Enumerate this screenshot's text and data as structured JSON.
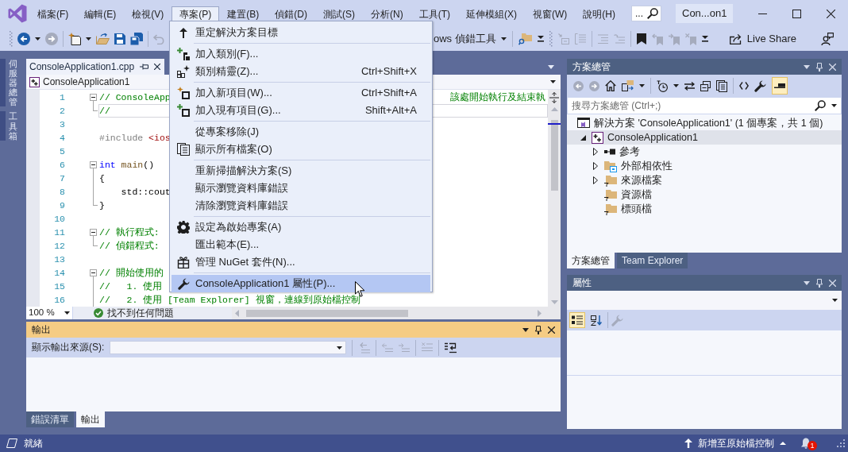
{
  "window": {
    "title": "Con...on1",
    "search": {
      "placeholder": "..."
    }
  },
  "menu_bar": [
    {
      "label": "檔案(F)",
      "selected": false
    },
    {
      "label": "編輯(E)",
      "selected": false
    },
    {
      "label": "檢視(V)",
      "selected": false
    },
    {
      "label": "專案(P)",
      "selected": true
    },
    {
      "label": "建置(B)",
      "selected": false
    },
    {
      "label": "偵錯(D)",
      "selected": false
    },
    {
      "label": "測試(S)",
      "selected": false
    },
    {
      "label": "分析(N)",
      "selected": false
    },
    {
      "label": "工具(T)",
      "selected": false
    },
    {
      "label": "延伸模組(X)",
      "selected": false
    },
    {
      "label": "視窗(W)",
      "selected": false
    },
    {
      "label": "說明(H)",
      "selected": false
    }
  ],
  "project_menu": {
    "groups": [
      [
        {
          "label": "重定解決方案目標",
          "selected": false
        }
      ],
      [
        {
          "label": "加入類別(F)...",
          "selected": false
        },
        {
          "label": "類別精靈(Z)...",
          "shortcut": "Ctrl+Shift+X",
          "selected": false
        }
      ],
      [
        {
          "label": "加入新項目(W)...",
          "shortcut": "Ctrl+Shift+A",
          "selected": false
        },
        {
          "label": "加入現有項目(G)...",
          "shortcut": "Shift+Alt+A",
          "selected": false
        }
      ],
      [
        {
          "label": "從專案移除(J)",
          "selected": false
        },
        {
          "label": "顯示所有檔案(O)",
          "selected": false
        }
      ],
      [
        {
          "label": "重新掃描解決方案(S)",
          "selected": false
        },
        {
          "label": "顯示瀏覽資料庫錯誤",
          "selected": false
        },
        {
          "label": "清除瀏覽資料庫錯誤",
          "selected": false
        }
      ],
      [
        {
          "label": "設定為啟始專案(A)",
          "selected": false
        },
        {
          "label": "匯出範本(E)...",
          "selected": false
        },
        {
          "label": "管理 NuGet 套件(N)...",
          "selected": false
        }
      ],
      [
        {
          "label": "ConsoleApplication1 屬性(P)...",
          "selected": true
        }
      ]
    ]
  },
  "toolbar": {
    "debug_target": "ows 偵錯工具",
    "live_share": "Live Share"
  },
  "side_tabs": [
    {
      "label": "伺服器總管"
    },
    {
      "label": "工具箱"
    }
  ],
  "editor": {
    "tab": "ConsoleApplication1.cpp",
    "navigation": "ConsoleApplication1",
    "lines": [
      {
        "number": "1",
        "kind": "open",
        "current": false,
        "parts": [
          {
            "kind": "comment",
            "text": "// ConsoleApp"
          }
        ],
        "parts_right": [
          {
            "kind": "comment",
            "text": "該處開始執行及結束執"
          }
        ]
      },
      {
        "number": "2",
        "kind": "close",
        "current": true,
        "parts": [
          {
            "kind": "comment",
            "text": "//"
          }
        ]
      },
      {
        "number": "3",
        "kind": "plain",
        "current": false
      },
      {
        "number": "4",
        "kind": "plain",
        "current": false,
        "parts": [
          {
            "kind": "preprocessor",
            "text": "#include"
          },
          {
            "kind": "string",
            "text": " <ios"
          }
        ]
      },
      {
        "number": "5",
        "kind": "plain",
        "current": false
      },
      {
        "number": "6",
        "kind": "open",
        "current": false,
        "parts": [
          {
            "kind": "keyword",
            "text": "int"
          },
          {
            "kind": "function",
            "text": " main"
          },
          {
            "kind": "plain",
            "text": "()"
          }
        ]
      },
      {
        "number": "7",
        "kind": "inner",
        "current": false,
        "parts": [
          {
            "kind": "plain",
            "text": "{"
          }
        ]
      },
      {
        "number": "8",
        "kind": "inner",
        "current": false,
        "parts": [
          {
            "kind": "plain",
            "text": "    std::cout"
          }
        ]
      },
      {
        "number": "9",
        "kind": "close",
        "current": false,
        "parts": [
          {
            "kind": "plain",
            "text": "}"
          }
        ]
      },
      {
        "number": "10",
        "kind": "plain",
        "current": false
      },
      {
        "number": "11",
        "kind": "open",
        "current": false,
        "parts": [
          {
            "kind": "comment",
            "text": "// 執行程式:"
          }
        ]
      },
      {
        "number": "12",
        "kind": "close",
        "current": false,
        "parts": [
          {
            "kind": "comment",
            "text": "// 偵錯程式:"
          }
        ]
      },
      {
        "number": "13",
        "kind": "plain",
        "current": false
      },
      {
        "number": "14",
        "kind": "open",
        "current": false,
        "parts": [
          {
            "kind": "comment",
            "text": "// 開始使用的"
          }
        ]
      },
      {
        "number": "15",
        "kind": "inner",
        "current": false,
        "parts": [
          {
            "kind": "comment",
            "text": "//   1. 使用"
          }
        ]
      },
      {
        "number": "16",
        "kind": "inner",
        "current": false,
        "parts": [
          {
            "kind": "comment",
            "text": "//   2. 使用 [Team Explorer] 視窗，連線到原始檔控制"
          }
        ]
      }
    ],
    "zoom": "100 %",
    "status": "找不到任何問題"
  },
  "solution_explorer": {
    "title": "方案總管",
    "active": false,
    "preview_toggle": {
      "on": true
    },
    "search": {
      "placeholder": "搜尋方案總管 (Ctrl+;)"
    },
    "tree": [
      {
        "kind": "solution",
        "label": "解決方案 'ConsoleApplication1' (1 個專案，共 1 個)",
        "selected": false,
        "children": [
          {
            "kind": "project",
            "label": "ConsoleApplication1",
            "expanded": true,
            "selected": true,
            "children": [
              {
                "kind": "references",
                "label": "參考",
                "expanded": false,
                "selected": false
              },
              {
                "kind": "external",
                "label": "外部相依性",
                "expanded": false,
                "selected": false
              },
              {
                "kind": "filter",
                "label": "來源檔案",
                "expanded": false,
                "selected": false
              },
              {
                "kind": "filter",
                "label": "資源檔",
                "selected": false
              },
              {
                "kind": "filter",
                "label": "標頭檔",
                "selected": false
              }
            ]
          }
        ]
      }
    ],
    "tabs": [
      {
        "label": "方案總管",
        "selected": true
      },
      {
        "label": "Team Explorer",
        "selected": false
      }
    ]
  },
  "properties": {
    "title": "屬性",
    "active": false,
    "categorized_view": {
      "selected": true
    },
    "alphabetical_view": {
      "selected": false
    }
  },
  "output": {
    "title": "輸出",
    "active": true,
    "source_label": "顯示輸出來源(S):",
    "tabs": [
      {
        "label": "錯誤清單",
        "selected": false
      },
      {
        "label": "輸出",
        "selected": true
      }
    ]
  },
  "status_bar": {
    "text": "就緒",
    "source_control": "新增至原始檔控制",
    "notifications": "1"
  }
}
